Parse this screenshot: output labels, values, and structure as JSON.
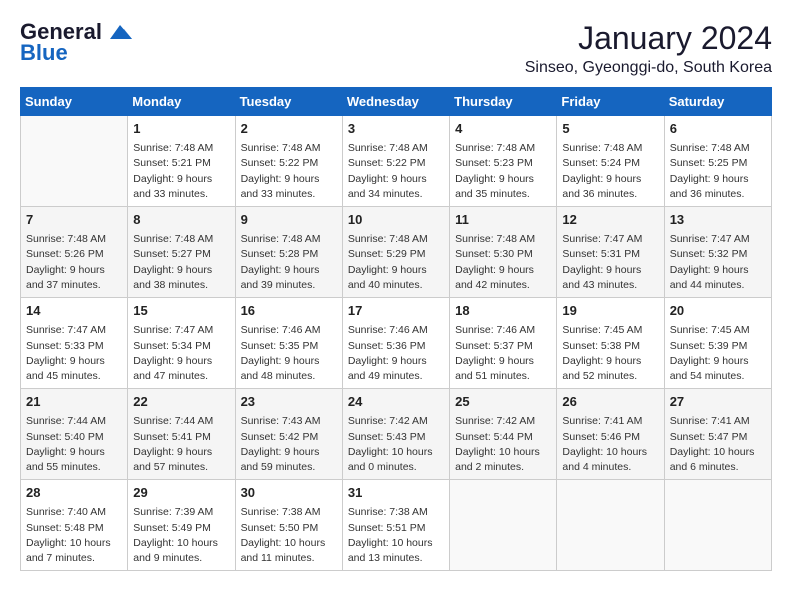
{
  "logo": {
    "line1": "General",
    "line2": "Blue"
  },
  "title": "January 2024",
  "location": "Sinseo, Gyeonggi-do, South Korea",
  "days_of_week": [
    "Sunday",
    "Monday",
    "Tuesday",
    "Wednesday",
    "Thursday",
    "Friday",
    "Saturday"
  ],
  "weeks": [
    [
      {
        "day": "",
        "sunrise": "",
        "sunset": "",
        "daylight": ""
      },
      {
        "day": "1",
        "sunrise": "Sunrise: 7:48 AM",
        "sunset": "Sunset: 5:21 PM",
        "daylight": "Daylight: 9 hours and 33 minutes."
      },
      {
        "day": "2",
        "sunrise": "Sunrise: 7:48 AM",
        "sunset": "Sunset: 5:22 PM",
        "daylight": "Daylight: 9 hours and 33 minutes."
      },
      {
        "day": "3",
        "sunrise": "Sunrise: 7:48 AM",
        "sunset": "Sunset: 5:22 PM",
        "daylight": "Daylight: 9 hours and 34 minutes."
      },
      {
        "day": "4",
        "sunrise": "Sunrise: 7:48 AM",
        "sunset": "Sunset: 5:23 PM",
        "daylight": "Daylight: 9 hours and 35 minutes."
      },
      {
        "day": "5",
        "sunrise": "Sunrise: 7:48 AM",
        "sunset": "Sunset: 5:24 PM",
        "daylight": "Daylight: 9 hours and 36 minutes."
      },
      {
        "day": "6",
        "sunrise": "Sunrise: 7:48 AM",
        "sunset": "Sunset: 5:25 PM",
        "daylight": "Daylight: 9 hours and 36 minutes."
      }
    ],
    [
      {
        "day": "7",
        "sunrise": "Sunrise: 7:48 AM",
        "sunset": "Sunset: 5:26 PM",
        "daylight": "Daylight: 9 hours and 37 minutes."
      },
      {
        "day": "8",
        "sunrise": "Sunrise: 7:48 AM",
        "sunset": "Sunset: 5:27 PM",
        "daylight": "Daylight: 9 hours and 38 minutes."
      },
      {
        "day": "9",
        "sunrise": "Sunrise: 7:48 AM",
        "sunset": "Sunset: 5:28 PM",
        "daylight": "Daylight: 9 hours and 39 minutes."
      },
      {
        "day": "10",
        "sunrise": "Sunrise: 7:48 AM",
        "sunset": "Sunset: 5:29 PM",
        "daylight": "Daylight: 9 hours and 40 minutes."
      },
      {
        "day": "11",
        "sunrise": "Sunrise: 7:48 AM",
        "sunset": "Sunset: 5:30 PM",
        "daylight": "Daylight: 9 hours and 42 minutes."
      },
      {
        "day": "12",
        "sunrise": "Sunrise: 7:47 AM",
        "sunset": "Sunset: 5:31 PM",
        "daylight": "Daylight: 9 hours and 43 minutes."
      },
      {
        "day": "13",
        "sunrise": "Sunrise: 7:47 AM",
        "sunset": "Sunset: 5:32 PM",
        "daylight": "Daylight: 9 hours and 44 minutes."
      }
    ],
    [
      {
        "day": "14",
        "sunrise": "Sunrise: 7:47 AM",
        "sunset": "Sunset: 5:33 PM",
        "daylight": "Daylight: 9 hours and 45 minutes."
      },
      {
        "day": "15",
        "sunrise": "Sunrise: 7:47 AM",
        "sunset": "Sunset: 5:34 PM",
        "daylight": "Daylight: 9 hours and 47 minutes."
      },
      {
        "day": "16",
        "sunrise": "Sunrise: 7:46 AM",
        "sunset": "Sunset: 5:35 PM",
        "daylight": "Daylight: 9 hours and 48 minutes."
      },
      {
        "day": "17",
        "sunrise": "Sunrise: 7:46 AM",
        "sunset": "Sunset: 5:36 PM",
        "daylight": "Daylight: 9 hours and 49 minutes."
      },
      {
        "day": "18",
        "sunrise": "Sunrise: 7:46 AM",
        "sunset": "Sunset: 5:37 PM",
        "daylight": "Daylight: 9 hours and 51 minutes."
      },
      {
        "day": "19",
        "sunrise": "Sunrise: 7:45 AM",
        "sunset": "Sunset: 5:38 PM",
        "daylight": "Daylight: 9 hours and 52 minutes."
      },
      {
        "day": "20",
        "sunrise": "Sunrise: 7:45 AM",
        "sunset": "Sunset: 5:39 PM",
        "daylight": "Daylight: 9 hours and 54 minutes."
      }
    ],
    [
      {
        "day": "21",
        "sunrise": "Sunrise: 7:44 AM",
        "sunset": "Sunset: 5:40 PM",
        "daylight": "Daylight: 9 hours and 55 minutes."
      },
      {
        "day": "22",
        "sunrise": "Sunrise: 7:44 AM",
        "sunset": "Sunset: 5:41 PM",
        "daylight": "Daylight: 9 hours and 57 minutes."
      },
      {
        "day": "23",
        "sunrise": "Sunrise: 7:43 AM",
        "sunset": "Sunset: 5:42 PM",
        "daylight": "Daylight: 9 hours and 59 minutes."
      },
      {
        "day": "24",
        "sunrise": "Sunrise: 7:42 AM",
        "sunset": "Sunset: 5:43 PM",
        "daylight": "Daylight: 10 hours and 0 minutes."
      },
      {
        "day": "25",
        "sunrise": "Sunrise: 7:42 AM",
        "sunset": "Sunset: 5:44 PM",
        "daylight": "Daylight: 10 hours and 2 minutes."
      },
      {
        "day": "26",
        "sunrise": "Sunrise: 7:41 AM",
        "sunset": "Sunset: 5:46 PM",
        "daylight": "Daylight: 10 hours and 4 minutes."
      },
      {
        "day": "27",
        "sunrise": "Sunrise: 7:41 AM",
        "sunset": "Sunset: 5:47 PM",
        "daylight": "Daylight: 10 hours and 6 minutes."
      }
    ],
    [
      {
        "day": "28",
        "sunrise": "Sunrise: 7:40 AM",
        "sunset": "Sunset: 5:48 PM",
        "daylight": "Daylight: 10 hours and 7 minutes."
      },
      {
        "day": "29",
        "sunrise": "Sunrise: 7:39 AM",
        "sunset": "Sunset: 5:49 PM",
        "daylight": "Daylight: 10 hours and 9 minutes."
      },
      {
        "day": "30",
        "sunrise": "Sunrise: 7:38 AM",
        "sunset": "Sunset: 5:50 PM",
        "daylight": "Daylight: 10 hours and 11 minutes."
      },
      {
        "day": "31",
        "sunrise": "Sunrise: 7:38 AM",
        "sunset": "Sunset: 5:51 PM",
        "daylight": "Daylight: 10 hours and 13 minutes."
      },
      {
        "day": "",
        "sunrise": "",
        "sunset": "",
        "daylight": ""
      },
      {
        "day": "",
        "sunrise": "",
        "sunset": "",
        "daylight": ""
      },
      {
        "day": "",
        "sunrise": "",
        "sunset": "",
        "daylight": ""
      }
    ]
  ]
}
